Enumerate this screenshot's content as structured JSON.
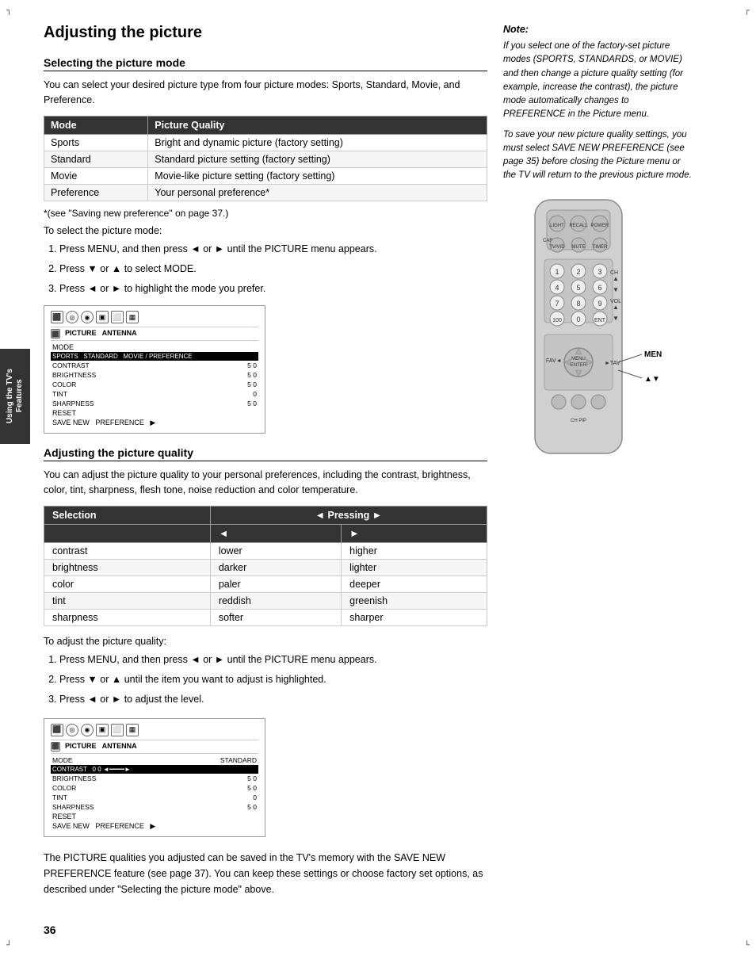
{
  "page": {
    "number": "36",
    "title": "Adjusting the picture",
    "corners": {
      "tl": "┐",
      "tr": "┌",
      "bl": "┘",
      "br": "└"
    }
  },
  "side_tab": {
    "line1": "Using the TV's",
    "line2": "Features"
  },
  "section1": {
    "title": "Selecting the picture mode",
    "intro": "You can select your desired picture type from four picture modes: Sports, Standard, Movie, and Preference.",
    "table": {
      "headers": [
        "Mode",
        "Picture Quality"
      ],
      "rows": [
        [
          "Sports",
          "Bright and dynamic picture (factory setting)"
        ],
        [
          "Standard",
          "Standard picture setting (factory setting)"
        ],
        [
          "Movie",
          "Movie-like picture setting (factory setting)"
        ],
        [
          "Preference",
          "Your personal preference*"
        ]
      ]
    },
    "footnote": "*(see \"Saving new preference\" on page 37.)",
    "instruction_label": "To select the picture mode:",
    "instructions": [
      "Press MENU, and then press ◄ or ► until the PICTURE menu appears.",
      "Press ▼ or ▲ to select MODE.",
      "Press ◄ or ► to highlight the mode you prefer."
    ]
  },
  "section2": {
    "title": "Adjusting the picture quality",
    "intro": "You can adjust the picture quality to your personal preferences, including the contrast, brightness, color, tint, sharpness, flesh tone, noise reduction and color temperature.",
    "pressing_table": {
      "headers": [
        "Selection",
        "◄ Pressing ►"
      ],
      "sub_headers": [
        "",
        "◄",
        "►"
      ],
      "rows": [
        [
          "contrast",
          "lower",
          "higher"
        ],
        [
          "brightness",
          "darker",
          "lighter"
        ],
        [
          "color",
          "paler",
          "deeper"
        ],
        [
          "tint",
          "reddish",
          "greenish"
        ],
        [
          "sharpness",
          "softer",
          "sharper"
        ]
      ]
    },
    "instruction_label": "To adjust the picture quality:",
    "instructions": [
      "Press MENU, and then press ◄ or ► until the PICTURE menu appears.",
      "Press ▼ or ▲ until the item you want to adjust is highlighted.",
      "Press ◄ or ► to adjust the level."
    ]
  },
  "bottom_text": "The PICTURE qualities you adjusted can be saved in the TV's memory with the SAVE NEW PREFERENCE feature (see page 37). You can keep these settings or choose factory set options, as described under \"Selecting the picture mode\" above.",
  "note": {
    "title": "Note:",
    "paragraphs": [
      "If you select one of the factory-set picture modes (SPORTS, STANDARDS, or MOVIE) and then change a picture quality setting (for example, increase the contrast), the picture mode automatically changes to PREFERENCE in the Picture menu.",
      "To save your new picture quality settings, you must select SAVE NEW PREFERENCE (see page 35) before closing the Picture menu or the TV will return to the previous picture mode."
    ]
  },
  "remote_labels": {
    "menu": "MENU",
    "arrows": "▲▼◄►"
  },
  "screen1": {
    "icons_count": 6,
    "label_row": "PICTURE  ANTENNA",
    "mode_row": "MODE",
    "highlight_row": "SPORTS  STANDARD  MOVIE  PREFERENCE",
    "rows": [
      "CONTRAST    5 0",
      "BRIGHTNESS  5 0",
      "COLOR       5 0",
      "TINT          0",
      "SHARPNESS   5 0",
      "RESET",
      "SAVE NEW  PREFERENCE"
    ]
  },
  "screen2": {
    "icons_count": 6,
    "label_row": "PICTURE  ANTENNA",
    "mode_row": "MODE        STANDARD",
    "highlight_row": "CONTRAST  0 0◄━━━━━━►",
    "rows": [
      "BRIGHTNESS  5 0",
      "COLOR       5 0",
      "TINT          0",
      "SHARPNESS   5 0",
      "RESET",
      "SAVE NEW  PREFERENCE"
    ]
  }
}
